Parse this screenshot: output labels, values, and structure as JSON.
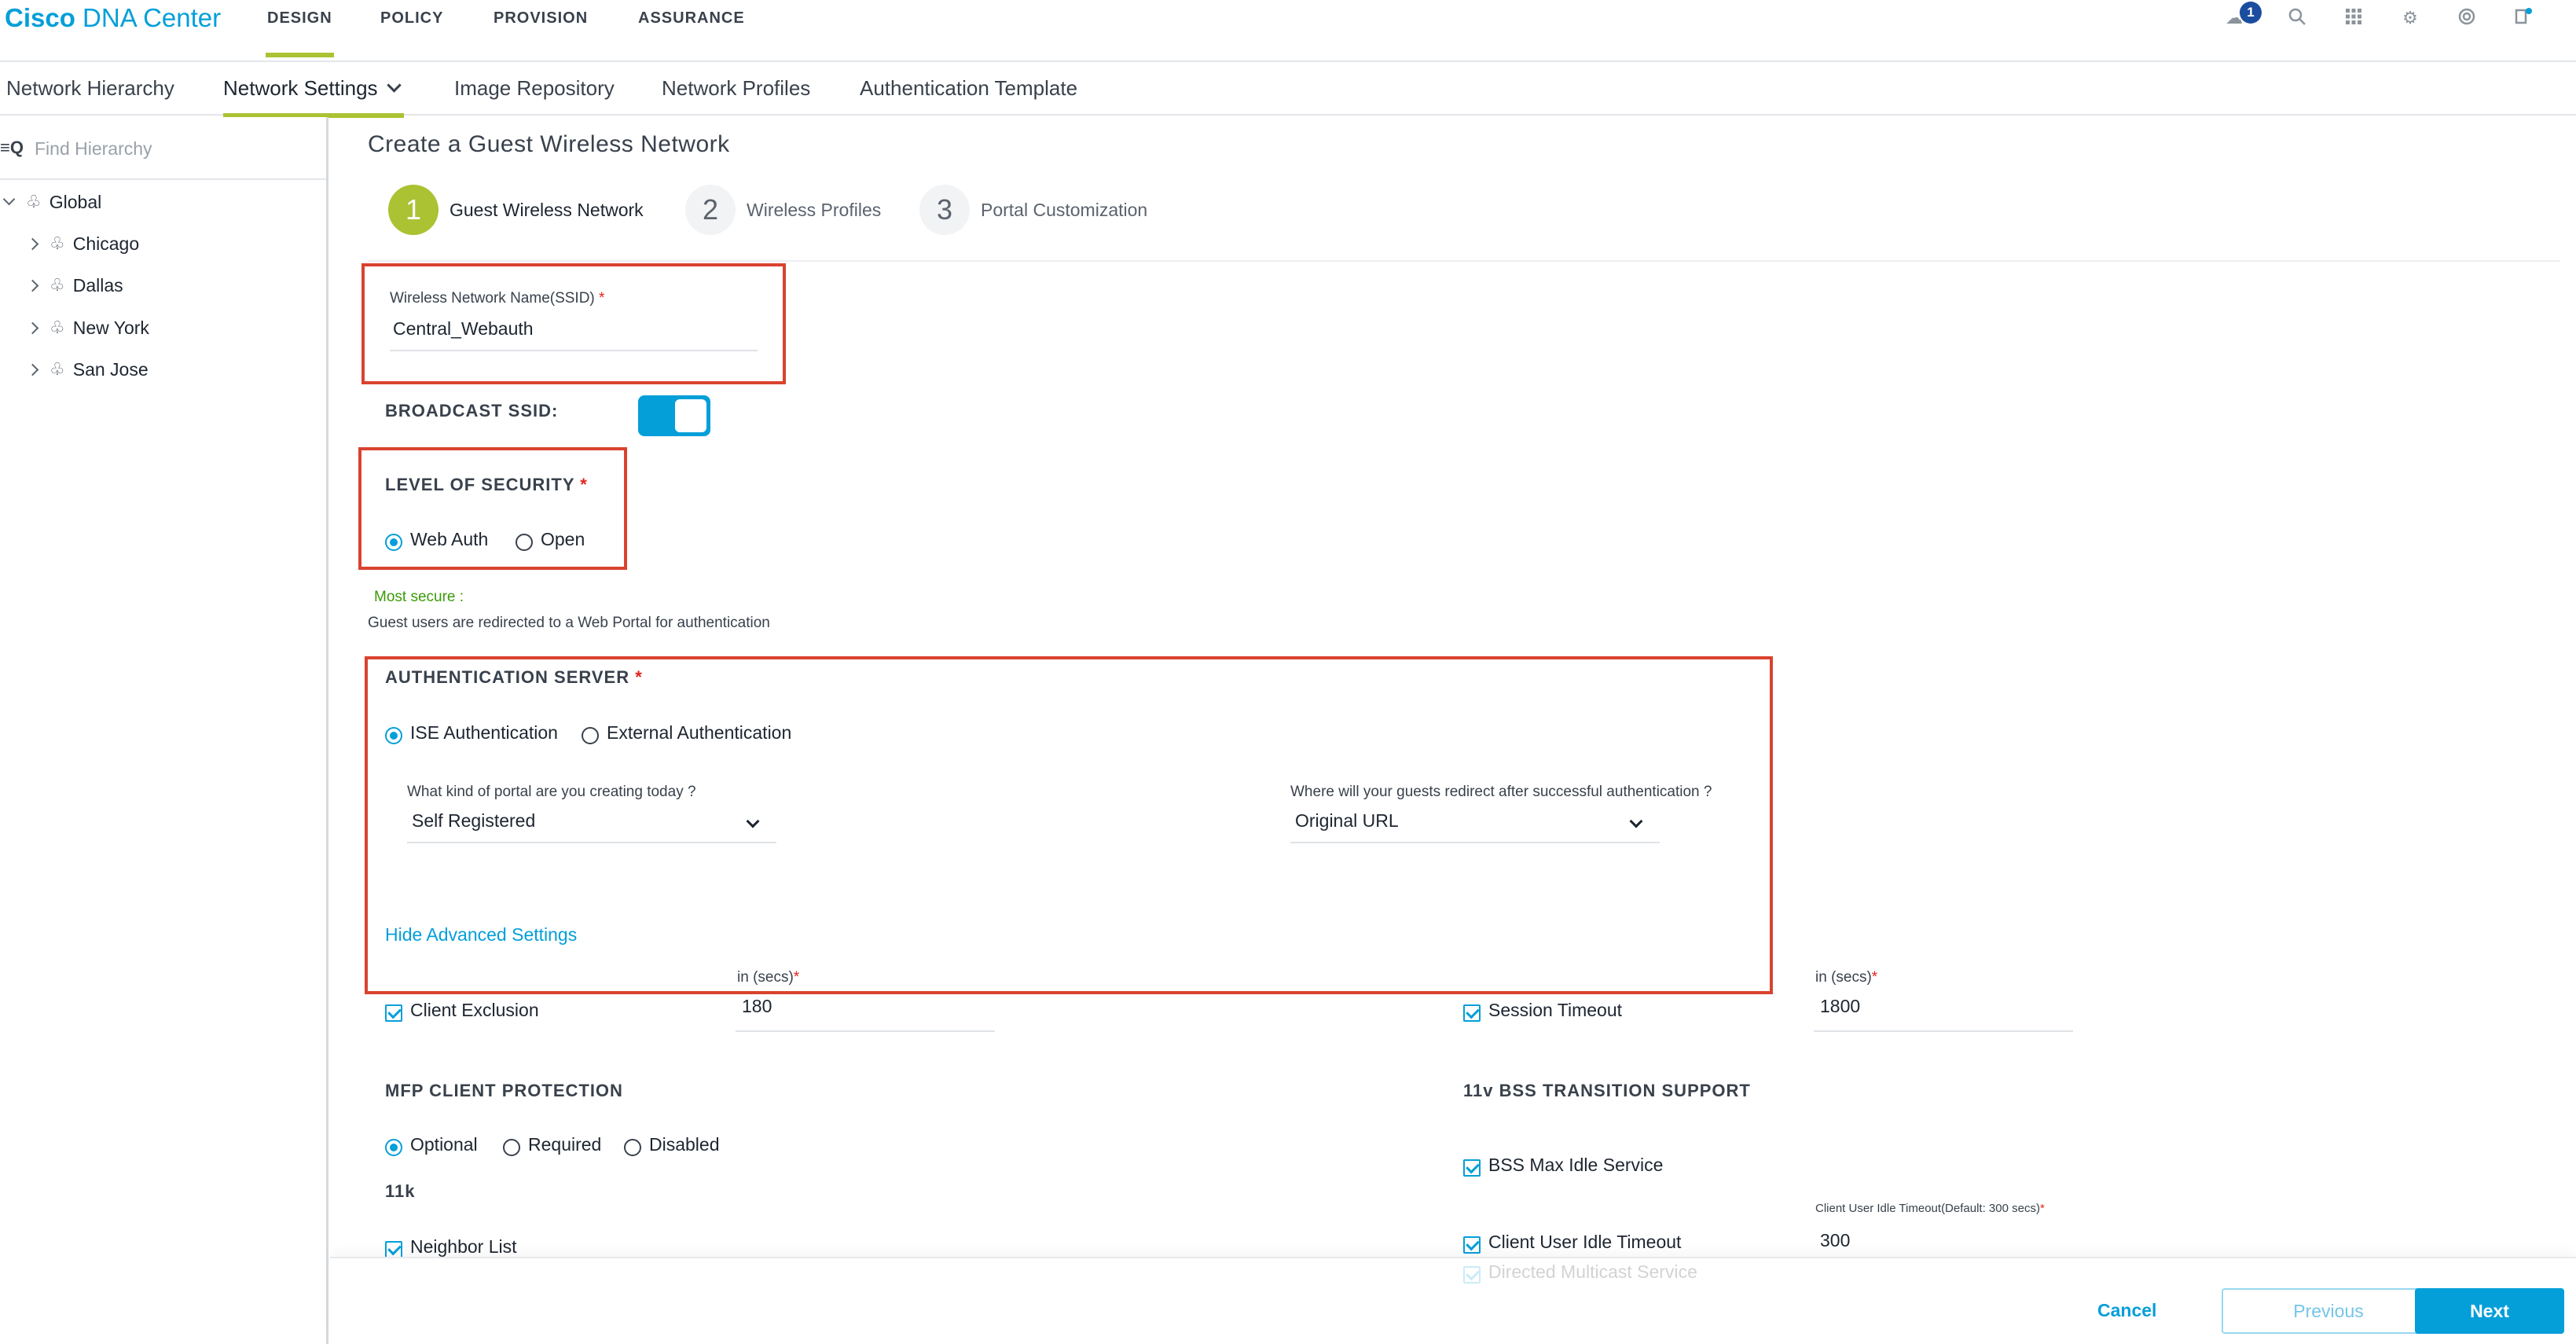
{
  "brand": {
    "part1": "Cisco",
    "part2": "DNA Center"
  },
  "topnav": {
    "items": [
      "DESIGN",
      "POLICY",
      "PROVISION",
      "ASSURANCE"
    ],
    "notification_count": "1"
  },
  "subnav": {
    "tabs": [
      "Network Hierarchy",
      "Network Settings",
      "Image Repository",
      "Network Profiles",
      "Authentication Template"
    ]
  },
  "sidebar": {
    "search_placeholder": "Find Hierarchy",
    "tree": [
      "Global",
      "Chicago",
      "Dallas",
      "New York",
      "San Jose"
    ]
  },
  "main": {
    "title": "Create a Guest Wireless Network",
    "steps": [
      {
        "num": "1",
        "label": "Guest Wireless Network"
      },
      {
        "num": "2",
        "label": "Wireless Profiles"
      },
      {
        "num": "3",
        "label": "Portal Customization"
      }
    ],
    "ssid": {
      "label": "Wireless Network Name(SSID)",
      "value": "Central_Webauth"
    },
    "broadcast_label": "BROADCAST SSID:",
    "security": {
      "heading": "LEVEL OF SECURITY",
      "options": [
        "Web Auth",
        "Open"
      ],
      "note_title": "Most secure :",
      "note_text": "Guest users are redirected to a Web Portal for authentication"
    },
    "auth_server": {
      "heading": "AUTHENTICATION SERVER",
      "options": [
        "ISE Authentication",
        "External Authentication"
      ],
      "portal_question": "What kind of portal are you creating today ?",
      "portal_value": "Self Registered",
      "redirect_question": "Where will your guests redirect after successful authentication ?",
      "redirect_value": "Original URL"
    },
    "advanced": {
      "toggle_link": "Hide Advanced Settings",
      "client_exclusion": {
        "label": "Client Exclusion",
        "unit": "in (secs)",
        "value": "180"
      },
      "session_timeout": {
        "label": "Session Timeout",
        "unit": "in (secs)",
        "value": "1800"
      },
      "mfp": {
        "heading": "MFP CLIENT PROTECTION",
        "options": [
          "Optional",
          "Required",
          "Disabled"
        ]
      },
      "bss": {
        "heading": "11v BSS TRANSITION SUPPORT"
      },
      "bss_max_idle": "BSS Max Idle Service",
      "client_user_idle": {
        "label": "Client User Idle Timeout",
        "unit": "Client User Idle Timeout(Default: 300 secs)",
        "value": "300"
      },
      "k11": "11k",
      "neighbor_list": "Neighbor List",
      "directed_multicast": "Directed Multicast Service"
    }
  },
  "footer": {
    "cancel": "Cancel",
    "previous": "Previous",
    "next": "Next"
  },
  "colors": {
    "accent": "#049fd9",
    "step_active": "#abc233",
    "highlight_box": "#d9432f",
    "secure_green": "#3a9b06"
  }
}
